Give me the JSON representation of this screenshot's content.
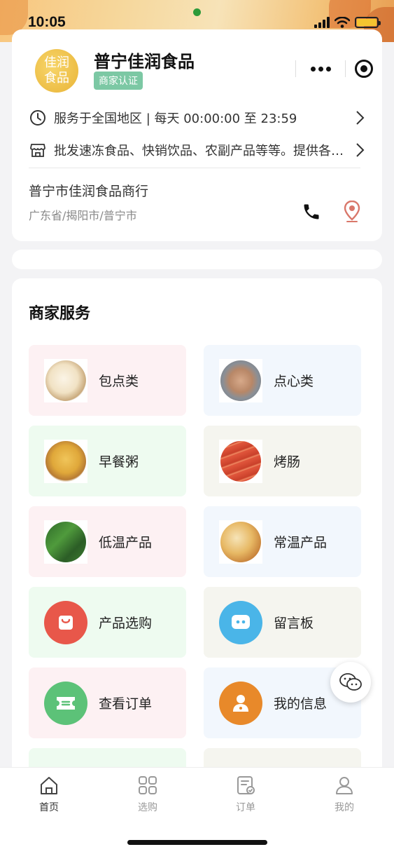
{
  "status_bar": {
    "time": "10:05"
  },
  "store": {
    "name": "普宁佳润食品",
    "cert_badge": "商家认证",
    "logo_text": "佳润食品",
    "service_hours": "服务于全国地区 | 每天 00:00:00 至 23:59",
    "business_scope": "批发速冻食品、快销饮品、农副产品等等。提供各类产品批发服务",
    "company": "普宁市佳润食品商行",
    "region": "广东省/揭阳市/普宁市"
  },
  "services": {
    "title": "商家服务",
    "items": [
      {
        "label": "包点类",
        "icon": "bun-image",
        "bg": "#fdf1f3"
      },
      {
        "label": "点心类",
        "icon": "dim-sum-image",
        "bg": "#f2f7fd"
      },
      {
        "label": "早餐粥",
        "icon": "congee-image",
        "bg": "#eefbf0"
      },
      {
        "label": "烤肠",
        "icon": "sausage-image",
        "bg": "#f5f5ef"
      },
      {
        "label": "低温产品",
        "icon": "chilled-product-image",
        "bg": "#fdf1f3"
      },
      {
        "label": "常温产品",
        "icon": "ambient-product-image",
        "bg": "#f2f7fd"
      },
      {
        "label": "产品选购",
        "icon": "shopping-bag-icon",
        "bg": "#eefbf0",
        "color": "#e8574a"
      },
      {
        "label": "留言板",
        "icon": "message-icon",
        "bg": "#f5f5ef",
        "color": "#4ab5e8"
      },
      {
        "label": "查看订单",
        "icon": "order-ticket-icon",
        "bg": "#fdf1f3",
        "color": "#5cc278"
      },
      {
        "label": "我的信息",
        "icon": "user-info-icon",
        "bg": "#f2f7fd",
        "color": "#e8892a"
      }
    ]
  },
  "tabbar": {
    "items": [
      {
        "label": "首页",
        "icon": "home-icon",
        "active": true
      },
      {
        "label": "选购",
        "icon": "grid-icon",
        "active": false
      },
      {
        "label": "订单",
        "icon": "order-icon",
        "active": false
      },
      {
        "label": "我的",
        "icon": "profile-icon",
        "active": false
      }
    ]
  }
}
